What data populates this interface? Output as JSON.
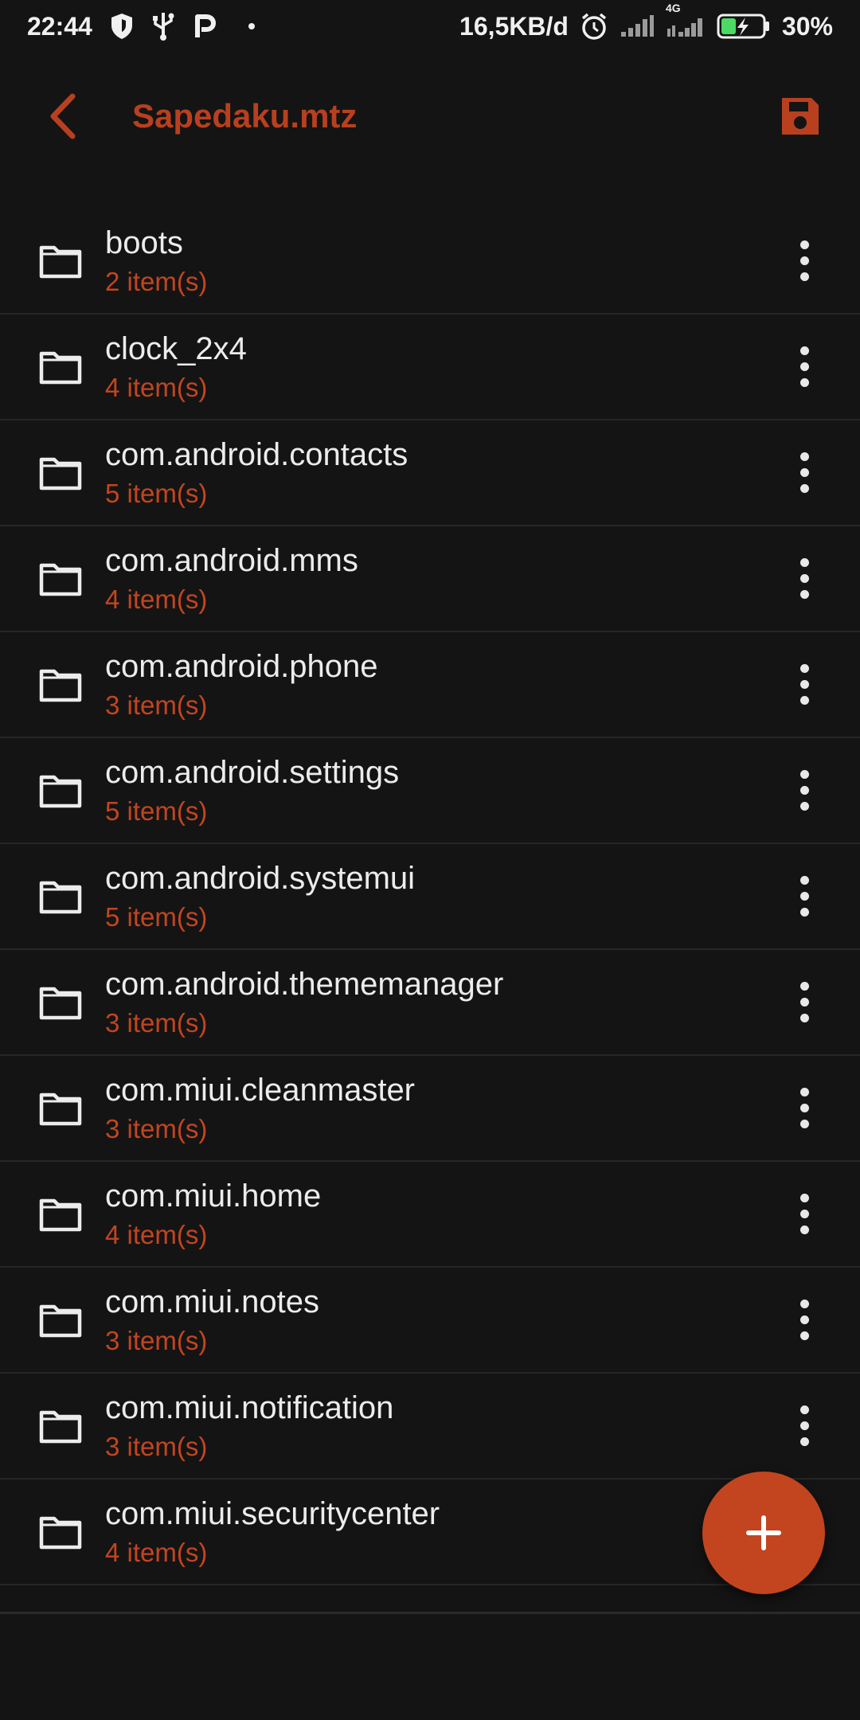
{
  "status_bar": {
    "time": "22:44",
    "net_speed": "16,5KB/d",
    "network_type": "4G",
    "battery": "30%",
    "icons": [
      "shield-icon",
      "usb-icon",
      "p-app-icon",
      "alarm-icon",
      "signal-icon",
      "battery-charging-icon"
    ]
  },
  "appbar": {
    "title": "Sapedaku.mtz",
    "back_icon": "chevron-left-icon",
    "save_icon": "save-icon"
  },
  "folders": [
    {
      "name": "boots",
      "count": "2 item(s)"
    },
    {
      "name": "clock_2x4",
      "count": "4 item(s)"
    },
    {
      "name": "com.android.contacts",
      "count": "5 item(s)"
    },
    {
      "name": "com.android.mms",
      "count": "4 item(s)"
    },
    {
      "name": "com.android.phone",
      "count": "3 item(s)"
    },
    {
      "name": "com.android.settings",
      "count": "5 item(s)"
    },
    {
      "name": "com.android.systemui",
      "count": "5 item(s)"
    },
    {
      "name": "com.android.thememanager",
      "count": "3 item(s)"
    },
    {
      "name": "com.miui.cleanmaster",
      "count": "3 item(s)"
    },
    {
      "name": "com.miui.home",
      "count": "4 item(s)"
    },
    {
      "name": "com.miui.notes",
      "count": "3 item(s)"
    },
    {
      "name": "com.miui.notification",
      "count": "3 item(s)"
    },
    {
      "name": "com.miui.securitycenter",
      "count": "4 item(s)"
    }
  ],
  "fab": {
    "icon": "plus-icon",
    "label": "+"
  },
  "colors": {
    "accent": "#c2451f",
    "title": "#b8401f",
    "background": "#141414",
    "divider": "#262626",
    "text": "#ececec"
  }
}
